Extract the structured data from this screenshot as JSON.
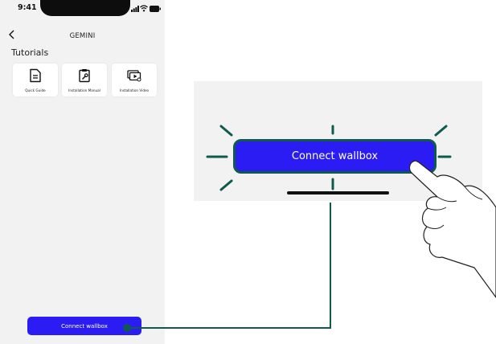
{
  "status_bar": {
    "time": "9:41"
  },
  "nav": {
    "title": "GEMINI"
  },
  "tutorials": {
    "heading": "Tutorials",
    "cards": [
      {
        "label": "Quick Guide",
        "icon": "document-icon"
      },
      {
        "label": "Installation Manual",
        "icon": "clipboard-wrench-icon"
      },
      {
        "label": "Installation Video",
        "icon": "video-play-icon"
      }
    ]
  },
  "connect_button": {
    "label": "Connect wallbox"
  },
  "zoom": {
    "button_label": "Connect wallbox"
  },
  "colors": {
    "accent": "#2b1cf4",
    "connector": "#0e5a4c",
    "screen_bg": "#f2f2f2"
  }
}
